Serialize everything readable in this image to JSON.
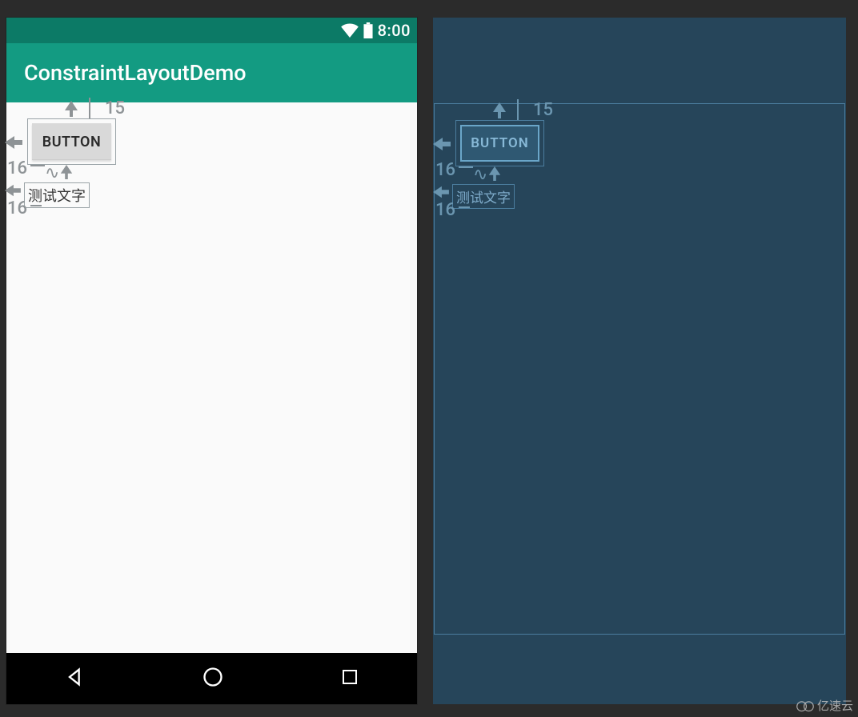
{
  "statusbar": {
    "time": "8:00"
  },
  "appbar": {
    "title": "ConstraintLayoutDemo"
  },
  "widgets": {
    "button": {
      "label": "BUTTON"
    },
    "textview": {
      "text": "测试文字"
    }
  },
  "constraints": {
    "button": {
      "top": "15",
      "left": "16"
    },
    "textview": {
      "left": "16"
    }
  },
  "watermark": {
    "text": "亿速云"
  }
}
